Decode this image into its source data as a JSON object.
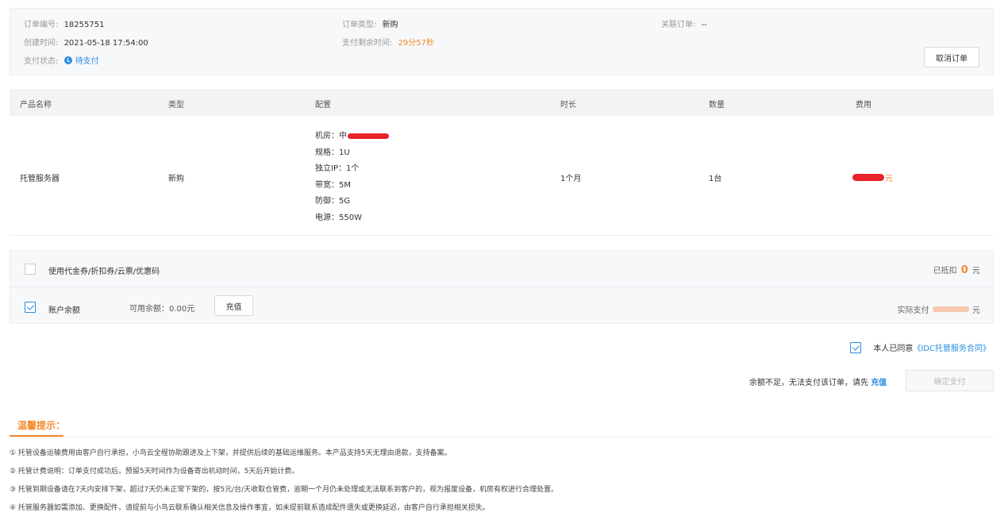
{
  "order": {
    "number_label": "订单编号:",
    "number_value": "18255751",
    "created_label": "创建时间:",
    "created_value": "2021-05-18 17:54:00",
    "pay_status_label": "支付状态:",
    "pay_status_value": "待支付",
    "type_label": "订单类型:",
    "type_value": "新购",
    "remain_label": "支付剩余时间:",
    "remain_value": "29分57秒",
    "related_label": "关联订单:",
    "related_value": "--",
    "cancel_label": "取消订单"
  },
  "table": {
    "headers": [
      "产品名称",
      "类型",
      "配置",
      "时长",
      "数量",
      "费用"
    ],
    "row": {
      "product": "托管服务器",
      "type": "新购",
      "config": [
        "机房：中",
        "规格：1U",
        "独立IP：1个",
        "带宽：5M",
        "防御：5G",
        "电源：550W"
      ],
      "duration": "1个月",
      "quantity": "1台",
      "fee_unit": "元"
    }
  },
  "payment": {
    "voucher_label": "使用代金券/折扣券/云票/优惠码",
    "deducted_label": "已抵扣",
    "deducted_value": "0",
    "deducted_unit": "元",
    "balance_label": "账户余额",
    "available_label": "可用余额：0.00元",
    "recharge_label": "充值",
    "actual_label": "实际支付",
    "actual_unit": "元"
  },
  "agreement": {
    "agree_text": "本人已同意",
    "contract_link": "《IDC托管服务合同》"
  },
  "submit": {
    "insufficient_text": "余额不足，无法支付该订单，请先",
    "recharge_link": "充值",
    "confirm_label": "确定支付"
  },
  "tips": {
    "title": "温馨提示：",
    "items": [
      "① 托管设备运输费用由客户自行承担，小鸟云全程协助跟进及上下架，并提供后续的基础运维服务。本产品支持5天无理由退款，支持备案。",
      "② 托管计费说明：订单支付成功后，预留5天时间作为设备寄出机动时间，5天后开始计费。",
      "③ 托管到期设备请在7天内安排下架，超过7天仍未正常下架的，按5元/台/天收取仓管费，逾期一个月仍未处理或无法联系到客户的，视为报废设备，机房有权进行合理处置。",
      "④ 托管服务器如需添加、更换配件，请提前与小鸟云联系确认相关信息及操作事宜，如未提前联系造成配件遗失或更换延迟，由客户自行承担相关损失。"
    ]
  },
  "colors": {
    "accent_orange": "#f28b2c",
    "link_blue": "#2a8de0",
    "redaction_red": "#e8232b"
  }
}
